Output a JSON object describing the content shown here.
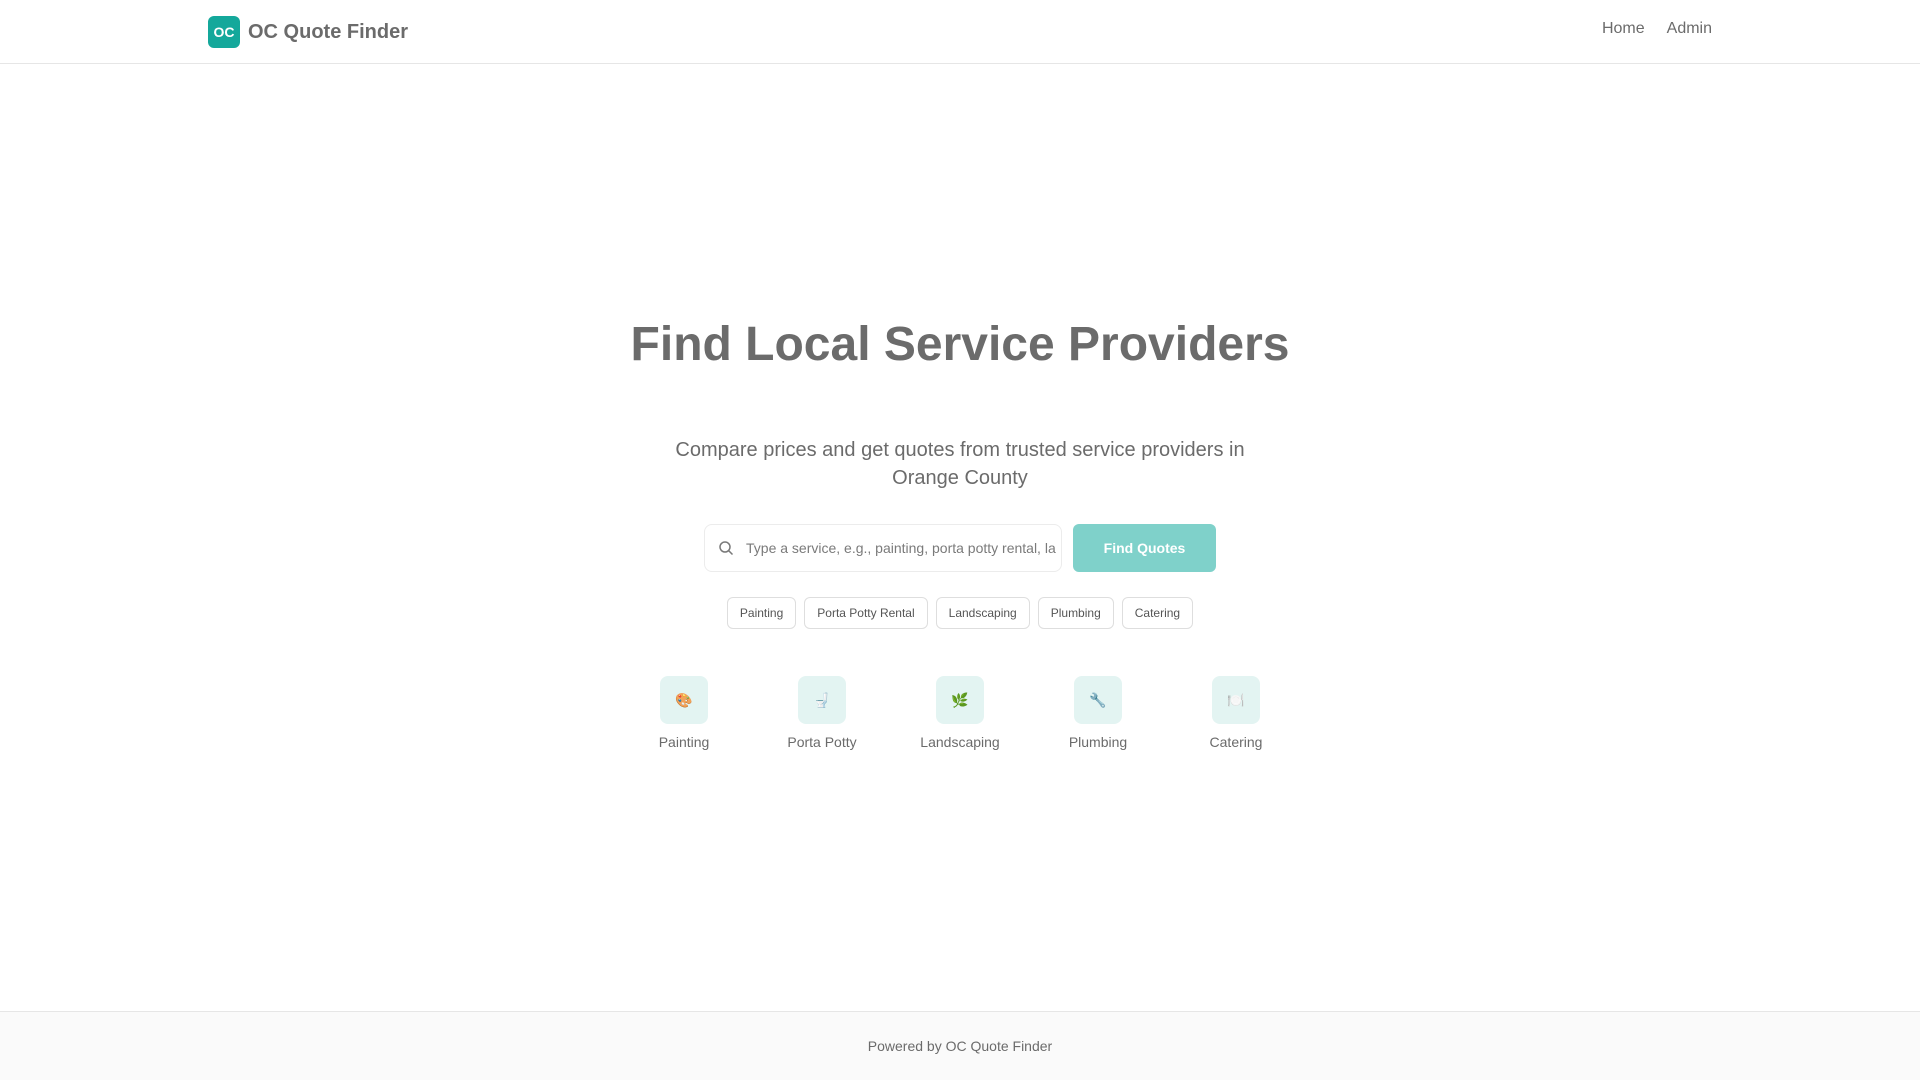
{
  "header": {
    "logo_text": "OC",
    "brand": "OC Quote Finder",
    "nav": [
      {
        "label": "Home"
      },
      {
        "label": "Admin"
      }
    ]
  },
  "hero": {
    "title": "Find Local Service Providers",
    "subtitle": "Compare prices and get quotes from trusted service providers in Orange County"
  },
  "search": {
    "placeholder": "Type a service, e.g., painting, porta potty rental, landscaping...",
    "value": "",
    "icon": "search-icon",
    "button_label": "Find Quotes"
  },
  "quick_tags": [
    {
      "label": "Painting"
    },
    {
      "label": "Porta Potty Rental"
    },
    {
      "label": "Landscaping"
    },
    {
      "label": "Plumbing"
    },
    {
      "label": "Catering"
    }
  ],
  "categories": [
    {
      "label": "Painting",
      "icon": "🎨",
      "icon_name": "palette-icon"
    },
    {
      "label": "Porta Potty",
      "icon": "🚽",
      "icon_name": "toilet-icon"
    },
    {
      "label": "Landscaping",
      "icon": "🌿",
      "icon_name": "leaf-icon"
    },
    {
      "label": "Plumbing",
      "icon": "🔧",
      "icon_name": "wrench-icon"
    },
    {
      "label": "Catering",
      "icon": "🍽️",
      "icon_name": "plate-icon"
    }
  ],
  "footer": {
    "text": "Powered by OC Quote Finder"
  },
  "colors": {
    "accent": "#14a89b",
    "button_bg": "#7fd1ca",
    "icon_tile_bg": "#e3f4f2",
    "text": "#6b6b6b"
  }
}
